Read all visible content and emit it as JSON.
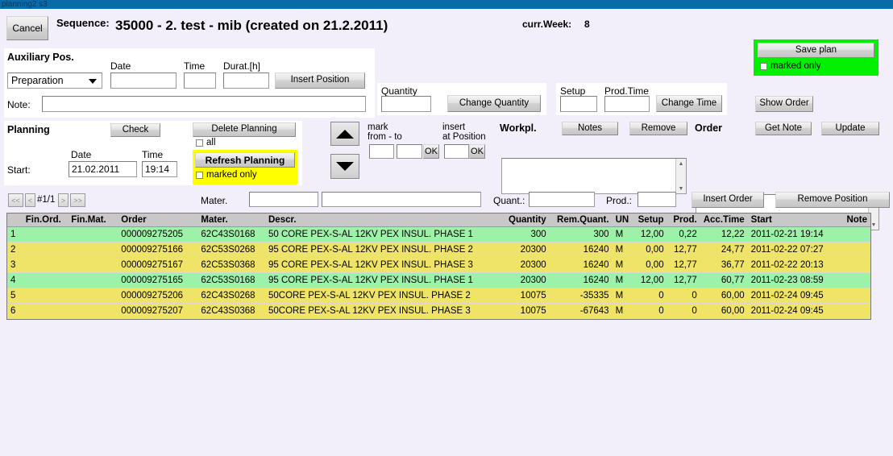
{
  "window": {
    "title": "planning2 s3"
  },
  "header": {
    "cancel_label": "Cancel",
    "sequence_label": "Sequence:",
    "sequence_value": "35000 - 2. test - mib (created on 21.2.2011)",
    "curr_week_label": "curr.Week:",
    "curr_week_value": "8"
  },
  "save": {
    "button_label": "Save plan",
    "marked_only_label": "marked only",
    "highlight_color": "#00f000"
  },
  "aux": {
    "title": "Auxiliary Pos.",
    "type_value": "Preparation",
    "date_label": "Date",
    "date_value": "",
    "time_label": "Time",
    "time_value": "",
    "duration_label": "Durat.[h]",
    "duration_value": "",
    "insert_position_label": "Insert Position",
    "note_label": "Note:",
    "note_value": ""
  },
  "quantity_box": {
    "label": "Quantity",
    "value": "",
    "button_label": "Change Quantity"
  },
  "time_box": {
    "setup_label": "Setup",
    "setup_value": "",
    "prodtime_label": "Prod.Time",
    "prodtime_value": "",
    "button_label": "Change Time"
  },
  "show_order_label": "Show Order",
  "planning": {
    "title": "Planning",
    "check_label": "Check",
    "delete_label": "Delete Planning",
    "all_label": "all",
    "refresh_label": "Refresh Planning",
    "marked_only_label": "marked only",
    "refresh_highlight_color": "#ffff00",
    "start_label": "Start:",
    "date_label": "Date",
    "date_value": "21.02.2011",
    "time_label": "Time",
    "time_value": "19:14"
  },
  "mark": {
    "mark_label_l1": "mark",
    "mark_label_l2": "from - to",
    "insert_label_l1": "insert",
    "insert_label_l2": "at Position",
    "from_value": "",
    "to_value": "",
    "position_value": "",
    "ok_label": "OK",
    "ok2_label": "OK"
  },
  "workpl": {
    "label": "Workpl.",
    "notes_label": "Notes",
    "remove_label": "Remove",
    "list_value": ""
  },
  "order": {
    "label": "Order",
    "get_note_label": "Get Note",
    "update_label": "Update",
    "list_value": ""
  },
  "pager": {
    "first_label": "<<",
    "prev_label": "<",
    "page_label": "#1/1",
    "next_label": ">",
    "last_label": ">>",
    "page_size": "10"
  },
  "filters": {
    "mater_label": "Mater.",
    "mater_value": "",
    "mater_desc_value": "",
    "quant_label": "Quant.:",
    "quant_value": "",
    "prod_label": "Prod.:",
    "prod_value": "",
    "insert_order_label": "Insert Order",
    "remove_position_label": "Remove Position"
  },
  "grid": {
    "columns": [
      {
        "key": "idx",
        "label": "",
        "align": "ta-l"
      },
      {
        "key": "fin_ord",
        "label": "Fin.Ord.",
        "align": "ta-l"
      },
      {
        "key": "fin_mat",
        "label": "Fin.Mat.",
        "align": "ta-l"
      },
      {
        "key": "order",
        "label": "Order",
        "align": "ta-l"
      },
      {
        "key": "mater",
        "label": "Mater.",
        "align": "ta-l"
      },
      {
        "key": "descr",
        "label": "Descr.",
        "align": "ta-l"
      },
      {
        "key": "quantity",
        "label": "Quantity",
        "align": "ta-r"
      },
      {
        "key": "rem_qty",
        "label": "Rem.Quant.",
        "align": "ta-r"
      },
      {
        "key": "un",
        "label": "UN",
        "align": "ta-l"
      },
      {
        "key": "setup",
        "label": "Setup",
        "align": "ta-r"
      },
      {
        "key": "prod",
        "label": "Prod.",
        "align": "ta-r"
      },
      {
        "key": "acc_time",
        "label": "Acc.Time",
        "align": "ta-r"
      },
      {
        "key": "start",
        "label": "Start",
        "align": "ta-l"
      },
      {
        "key": "note",
        "label": "Note",
        "align": "ta-r"
      }
    ],
    "rows": [
      {
        "idx": "1",
        "fin_ord": "",
        "fin_mat": "",
        "order": "000009275205",
        "mater": "62C43S0168",
        "descr": "50 CORE PEX-S-AL 12KV PEX INSUL. PHASE 1",
        "quantity": "300",
        "rem_qty": "300",
        "un": "M",
        "setup": "12,00",
        "prod": "0,22",
        "acc_time": "12,22",
        "start": "2011-02-21 19:14",
        "note": "",
        "style": "row-green"
      },
      {
        "idx": "2",
        "fin_ord": "",
        "fin_mat": "",
        "order": "000009275166",
        "mater": "62C53S0268",
        "descr": "95 CORE PEX-S-AL 12KV PEX INSUL. PHASE 2",
        "quantity": "20300",
        "rem_qty": "16240",
        "un": "M",
        "setup": "0,00",
        "prod": "12,77",
        "acc_time": "24,77",
        "start": "2011-02-22 07:27",
        "note": "",
        "style": "row-yellow"
      },
      {
        "idx": "3",
        "fin_ord": "",
        "fin_mat": "",
        "order": "000009275167",
        "mater": "62C53S0368",
        "descr": "95 CORE PEX-S-AL 12KV PEX INSUL. PHASE 3",
        "quantity": "20300",
        "rem_qty": "16240",
        "un": "M",
        "setup": "0,00",
        "prod": "12,77",
        "acc_time": "36,77",
        "start": "2011-02-22 20:13",
        "note": "",
        "style": "row-yellow"
      },
      {
        "idx": "4",
        "fin_ord": "",
        "fin_mat": "",
        "order": "000009275165",
        "mater": "62C53S0168",
        "descr": "95 CORE PEX-S-AL 12KV PEX INSUL. PHASE 1",
        "quantity": "20300",
        "rem_qty": "16240",
        "un": "M",
        "setup": "12,00",
        "prod": "12,77",
        "acc_time": "60,77",
        "start": "2011-02-23 08:59",
        "note": "",
        "style": "row-green"
      },
      {
        "idx": "5",
        "fin_ord": "",
        "fin_mat": "",
        "order": "000009275206",
        "mater": "62C43S0268",
        "descr": "50CORE PEX-S-AL 12KV PEX INSUL. PHASE 2",
        "quantity": "10075",
        "rem_qty": "-35335",
        "un": "M",
        "setup": "0",
        "prod": "0",
        "acc_time": "60,00",
        "start": "2011-02-24 09:45",
        "note": "",
        "style": "row-yellow"
      },
      {
        "idx": "6",
        "fin_ord": "",
        "fin_mat": "",
        "order": "000009275207",
        "mater": "62C43S0368",
        "descr": "50CORE PEX-S-AL 12KV PEX INSUL. PHASE 3",
        "quantity": "10075",
        "rem_qty": "-67643",
        "un": "M",
        "setup": "0",
        "prod": "0",
        "acc_time": "60,00",
        "start": "2011-02-24 09:45",
        "note": "",
        "style": "row-yellow"
      }
    ]
  }
}
